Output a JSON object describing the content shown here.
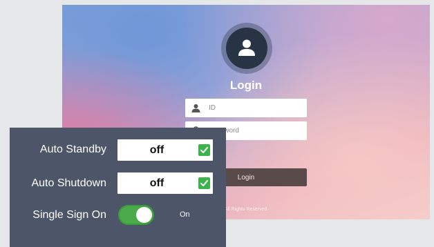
{
  "login": {
    "title": "Login",
    "id_placeholder": "ID",
    "password_placeholder": "Password",
    "button_label": "Login",
    "copyright": "© Bionet Co., Ltd. All Rights Reserved."
  },
  "settings": {
    "auto_standby": {
      "label": "Auto Standby",
      "value": "off",
      "checked": true
    },
    "auto_shutdown": {
      "label": "Auto Shutdown",
      "value": "off",
      "checked": true
    },
    "single_sign_on": {
      "label": "Single Sign On",
      "state": "On",
      "enabled": true
    }
  },
  "icons": {
    "avatar": "user-icon",
    "id_field": "user-icon",
    "password_field": "lock-icon",
    "checkbox": "checkmark-icon"
  },
  "colors": {
    "panel_bg": "#4c5668",
    "check_green": "#3bb54a",
    "toggle_green": "#4caa4a",
    "login_button": "#5a4b4b",
    "avatar_bg": "#283344"
  }
}
